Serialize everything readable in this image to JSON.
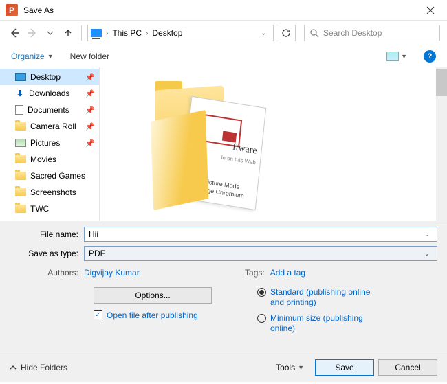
{
  "window": {
    "title": "Save As"
  },
  "breadcrumb": {
    "root": "This PC",
    "current": "Desktop"
  },
  "search": {
    "placeholder": "Search Desktop"
  },
  "toolbar": {
    "organize": "Organize",
    "newfolder": "New folder"
  },
  "sidebar": {
    "items": [
      {
        "label": "Desktop"
      },
      {
        "label": "Downloads"
      },
      {
        "label": "Documents"
      },
      {
        "label": "Camera Roll"
      },
      {
        "label": "Pictures"
      },
      {
        "label": "Movies"
      },
      {
        "label": "Sacred Games"
      },
      {
        "label": "Screenshots"
      },
      {
        "label": "TWC"
      }
    ]
  },
  "preview": {
    "snippet1": "ftware",
    "snippet2": "le on this Web",
    "snippet3": "re-In-Picture Mode",
    "snippet4": "soft Edge Chromium"
  },
  "form": {
    "filename_label": "File name:",
    "filename_value": "Hii",
    "savetype_label": "Save as type:",
    "savetype_value": "PDF",
    "authors_label": "Authors:",
    "authors_value": "Digvijay Kumar",
    "tags_label": "Tags:",
    "tags_value": "Add a tag"
  },
  "options": {
    "button": "Options...",
    "open_after": "Open file after publishing",
    "standard": "Standard (publishing online and printing)",
    "minimum": "Minimum size (publishing online)"
  },
  "footer": {
    "hide": "Hide Folders",
    "tools": "Tools",
    "save": "Save",
    "cancel": "Cancel"
  }
}
